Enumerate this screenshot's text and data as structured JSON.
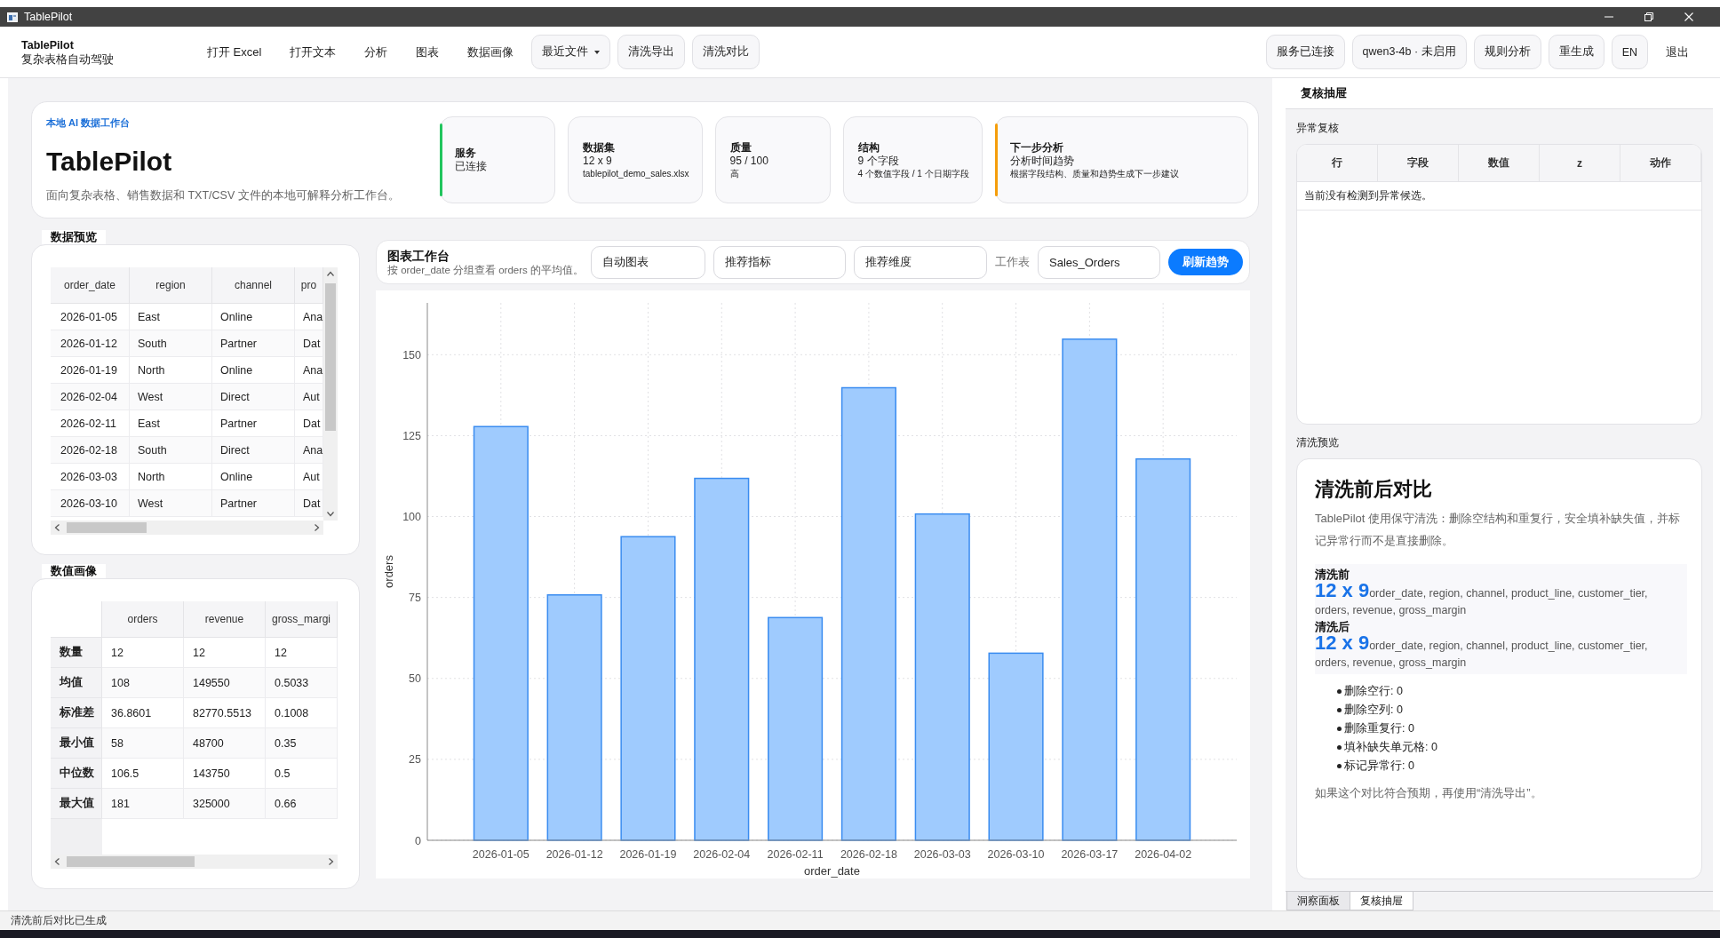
{
  "window": {
    "title": "TablePilot"
  },
  "menubar": {
    "brand": {
      "name": "TablePilot",
      "tagline": "复杂表格自动驾驶"
    },
    "items": [
      {
        "label": "打开 Excel",
        "kind": "plain"
      },
      {
        "label": "打开文本",
        "kind": "plain"
      },
      {
        "label": "分析",
        "kind": "plain"
      },
      {
        "label": "图表",
        "kind": "plain"
      },
      {
        "label": "数据画像",
        "kind": "plain"
      },
      {
        "label": "最近文件",
        "kind": "dropdown"
      },
      {
        "label": "清洗导出",
        "kind": "button"
      },
      {
        "label": "清洗对比",
        "kind": "button"
      }
    ],
    "actions": [
      {
        "label": "服务已连接",
        "kind": "button"
      },
      {
        "label": "qwen3-4b · 未启用",
        "kind": "button"
      },
      {
        "label": "规则分析",
        "kind": "button"
      },
      {
        "label": "重生成",
        "kind": "button"
      },
      {
        "label": "EN",
        "kind": "button"
      },
      {
        "label": "退出",
        "kind": "plain"
      }
    ]
  },
  "hero": {
    "eyebrow": "本地 AI 数据工作台",
    "title": "TablePilot",
    "description": "面向复杂表格、销售数据和 TXT/CSV 文件的本地可解释分析工作台。",
    "stats": [
      {
        "label": "服务",
        "value": "已连接",
        "color": "#22c55e"
      },
      {
        "label": "数据集",
        "value": "12 x 9",
        "note": "tablepilot_demo_sales.xlsx"
      },
      {
        "label": "质量",
        "value": "95 / 100",
        "note": "高"
      },
      {
        "label": "结构",
        "value": "9 个字段",
        "note": "4 个数值字段 / 1 个日期字段"
      },
      {
        "label": "下一步分析",
        "value": "分析时间趋势",
        "note": "根据字段结构、质量和趋势生成下一步建议",
        "color": "#f59e0b"
      }
    ]
  },
  "preview": {
    "title": "数据预览",
    "columns": [
      "order_date",
      "region",
      "channel",
      "pro"
    ],
    "rows": [
      [
        "2026-01-05",
        "East",
        "Online",
        "Ana"
      ],
      [
        "2026-01-12",
        "South",
        "Partner",
        "Dat"
      ],
      [
        "2026-01-19",
        "North",
        "Online",
        "Ana"
      ],
      [
        "2026-02-04",
        "West",
        "Direct",
        "Aut"
      ],
      [
        "2026-02-11",
        "East",
        "Partner",
        "Dat"
      ],
      [
        "2026-02-18",
        "South",
        "Direct",
        "Ana"
      ],
      [
        "2026-03-03",
        "North",
        "Online",
        "Aut"
      ],
      [
        "2026-03-10",
        "West",
        "Partner",
        "Dat"
      ]
    ]
  },
  "profile": {
    "title": "数值画像",
    "columns": [
      "orders",
      "revenue",
      "gross_margi"
    ],
    "rows": [
      {
        "label": "数量",
        "cells": [
          "12",
          "12",
          "12"
        ]
      },
      {
        "label": "均值",
        "cells": [
          "108",
          "149550",
          "0.5033"
        ]
      },
      {
        "label": "标准差",
        "cells": [
          "36.8601",
          "82770.5513",
          "0.1008"
        ]
      },
      {
        "label": "最小值",
        "cells": [
          "58",
          "48700",
          "0.35"
        ]
      },
      {
        "label": "中位数",
        "cells": [
          "106.5",
          "143750",
          "0.5"
        ]
      },
      {
        "label": "最大值",
        "cells": [
          "181",
          "325000",
          "0.66"
        ]
      }
    ]
  },
  "chart": {
    "toolbar": {
      "title": "图表工作台",
      "subtitle": "按 order_date 分组查看 orders 的平均值。",
      "selects": [
        "自动图表",
        "推荐指标",
        "推荐维度"
      ],
      "sheet_label": "工作表",
      "sheet": "Sales_Orders",
      "button": "刷新趋势"
    },
    "chart_data": {
      "type": "bar",
      "xlabel": "order_date",
      "ylabel": "orders",
      "categories": [
        "2026-01-05",
        "2026-01-12",
        "2026-01-19",
        "2026-02-04",
        "2026-02-11",
        "2026-02-18",
        "2026-03-03",
        "2026-03-10",
        "2026-03-17",
        "2026-04-02"
      ],
      "values": [
        128,
        76,
        94,
        112,
        69,
        140,
        101,
        58,
        155,
        118
      ],
      "ylim": [
        0,
        166
      ],
      "yticks": [
        0,
        25,
        50,
        75,
        100,
        125,
        150
      ],
      "grid": true
    }
  },
  "drawer": {
    "title": "复核抽屉",
    "anomaly_review": {
      "label": "异常复核",
      "columns": [
        "行",
        "字段",
        "数值",
        "z",
        "动作"
      ],
      "message": "当前没有检测到异常候选。"
    },
    "clean_preview": {
      "label": "清洗预览",
      "title": "清洗前后对比",
      "description": "TablePilot 使用保守清洗：删除空结构和重复行，安全填补缺失值，并标记异常行而不是直接删除。",
      "comparisons": [
        {
          "label": "清洗前",
          "summary": "**12 x 9**order_date, region, channel, product_line, customer_tier, orders, revenue, gross_margin"
        },
        {
          "label": "清洗后",
          "summary": "**12 x 9**order_date, region, channel, product_line, customer_tier, orders, revenue, gross_margin"
        }
      ],
      "stats": [
        "删除空行: 0",
        "删除空列: 0",
        "删除重复行: 0",
        "填补缺失单元格: 0",
        "标记异常行: 0"
      ],
      "note": "如果这个对比符合预期，再使用“清洗导出”。"
    },
    "tabs": [
      {
        "label": "洞察面板",
        "selected": false
      },
      {
        "label": "复核抽屉",
        "selected": true
      }
    ]
  },
  "status_bar": {
    "message": "清洗前后对比已生成"
  }
}
